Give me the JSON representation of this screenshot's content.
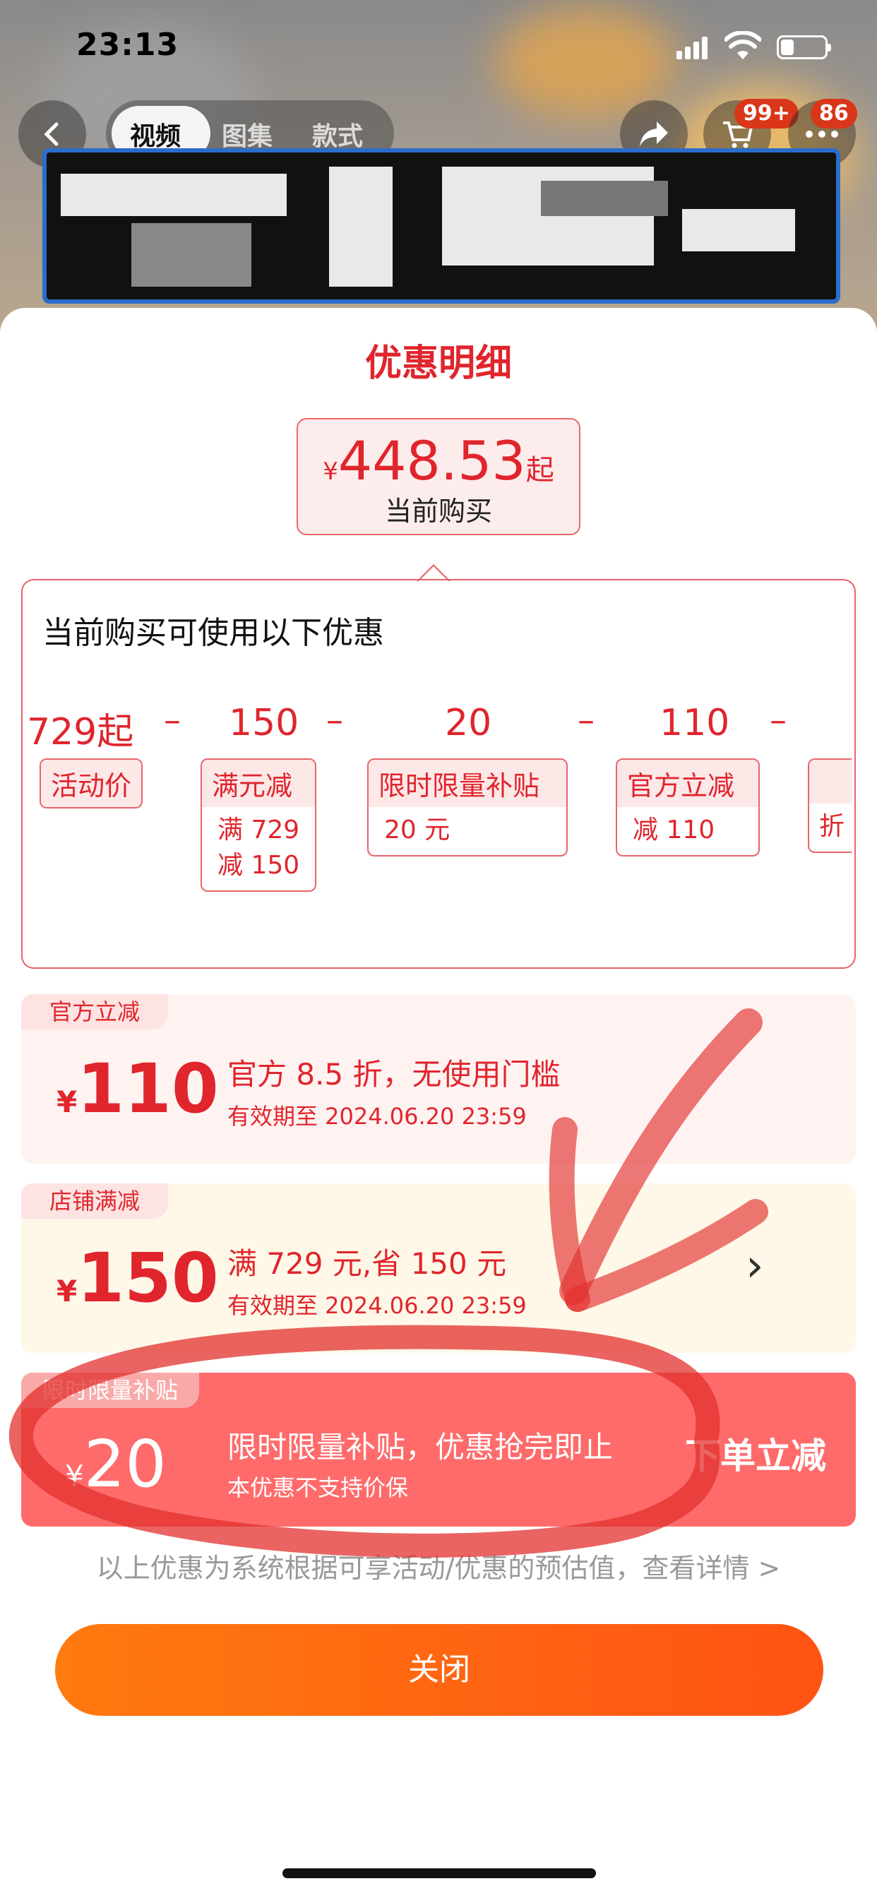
{
  "status_bar": {
    "time": "23:13"
  },
  "nav": {
    "tabs": [
      "视频",
      "图集",
      "款式"
    ],
    "cart_badge": "99+",
    "more_badge": "86"
  },
  "sheet": {
    "title": "优惠明细",
    "price": {
      "currency": "¥",
      "amount": "448.53",
      "suffix": "起",
      "label": "当前购买"
    },
    "breakdown": {
      "heading": "当前购买可使用以下优惠",
      "values": [
        "729起",
        "150",
        "20",
        "110"
      ],
      "chips": [
        {
          "title": "活动价",
          "body": []
        },
        {
          "title": "满元减",
          "body": [
            "满 729",
            "减 150"
          ]
        },
        {
          "title": "限时限量补贴",
          "body": [
            "20 元"
          ]
        },
        {
          "title": "官方立减",
          "body": [
            "减 110"
          ]
        },
        {
          "title": "",
          "body": [
            "折"
          ]
        }
      ]
    },
    "coupons": [
      {
        "tag": "官方立减",
        "currency": "¥",
        "amount": "110",
        "title": "官方 8.5 折，无使用门槛",
        "subtitle": "有效期至 2024.06.20 23:59",
        "action": ""
      },
      {
        "tag": "店铺满减",
        "currency": "¥",
        "amount": "150",
        "title": "满 729 元,省 150 元",
        "subtitle": "有效期至 2024.06.20 23:59",
        "action": "›"
      },
      {
        "tag": "限时限量补贴",
        "currency": "¥",
        "amount": "20",
        "title": "限时限量补贴，优惠抢完即止",
        "subtitle": "本优惠不支持价保",
        "action": "下单立减"
      }
    ],
    "note": "以上优惠为系统根据可享活动/优惠的预估值，查看详情 >",
    "close_label": "关闭"
  },
  "colors": {
    "accent_red": "#e0252d",
    "close_gradient_start": "#ff7a0f",
    "close_gradient_end": "#ff5314",
    "coupon_pink_bg": "#fff3f2",
    "coupon_yellow_bg": "#fff8e8",
    "coupon_red_bg": "#ff6b6b"
  }
}
